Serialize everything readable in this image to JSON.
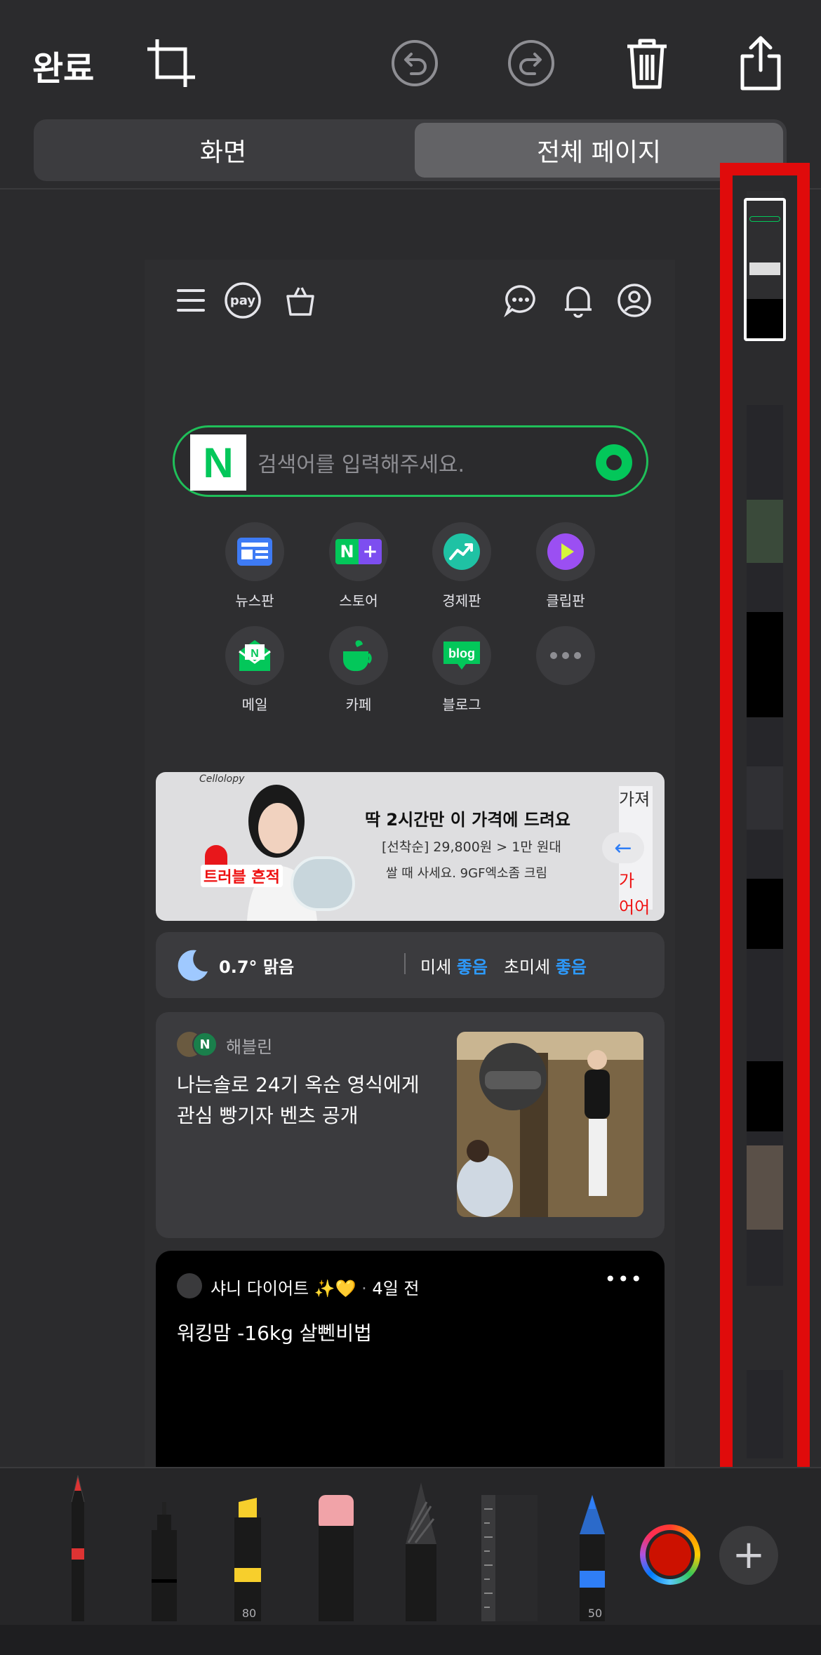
{
  "toolbar": {
    "done_label": "완료",
    "icons": [
      "crop-icon",
      "undo-icon",
      "redo-icon",
      "trash-icon",
      "share-icon"
    ]
  },
  "segment": {
    "left_label": "화면",
    "right_label": "전체 페이지",
    "selected": "전체 페이지"
  },
  "preview": {
    "header_icons": [
      "menu-icon",
      "pay-icon",
      "shopping-bag-icon",
      "chat-icon",
      "bell-icon",
      "profile-icon"
    ],
    "pay_text": "pay",
    "search": {
      "logo": "N",
      "placeholder": "검색어를 입력해주세요."
    },
    "shortcuts": [
      {
        "label": "뉴스판",
        "icon": "news-icon"
      },
      {
        "label": "스토어",
        "icon": "store-icon"
      },
      {
        "label": "경제판",
        "icon": "chart-up-icon"
      },
      {
        "label": "클립판",
        "icon": "play-icon"
      },
      {
        "label": "메일",
        "icon": "mail-icon"
      },
      {
        "label": "카페",
        "icon": "cup-icon"
      },
      {
        "label": "블로그",
        "icon": "blog-icon"
      },
      {
        "label": "",
        "icon": "more-icon"
      }
    ],
    "store_logo": "N +",
    "mail_logo": "N",
    "blog_logo": "blog",
    "banner": {
      "brand": "Cellolopy",
      "tag": "트러블 흔적",
      "title": "딱 2시간만 이 가격에 드려요",
      "sub1": "[선착순] 29,800원 > 1만 원대",
      "sub2": "쌀 때 사세요. 9GF엑소좀 크림",
      "side_lines": [
        "가져",
        "로 가",
        "어어"
      ]
    },
    "weather": {
      "temp": "0.7° 맑음",
      "fine_dust_label": "미세",
      "fine_dust_value": "좋음",
      "ultrafine_label": "초미세",
      "ultrafine_value": "좋음"
    },
    "news": {
      "source": "해블린",
      "avatar_letter": "N",
      "title": "나는솔로 24기 옥순 영식에게 관심 빵기자 벤츠 공개"
    },
    "post": {
      "author": "샤니 다이어트 ✨💛",
      "time": "4일 전",
      "title": "워킹맘 -16kg 살뻰비법",
      "more": "•••"
    }
  },
  "tools": {
    "highlighter_size": "80",
    "pencil_size": "50",
    "selected_color": "#cc1100",
    "plus_label": "+"
  },
  "colors": {
    "accent_green": "#03c75a",
    "thumb_border_red": "#e00b0b",
    "good_blue": "#2d9bff"
  }
}
